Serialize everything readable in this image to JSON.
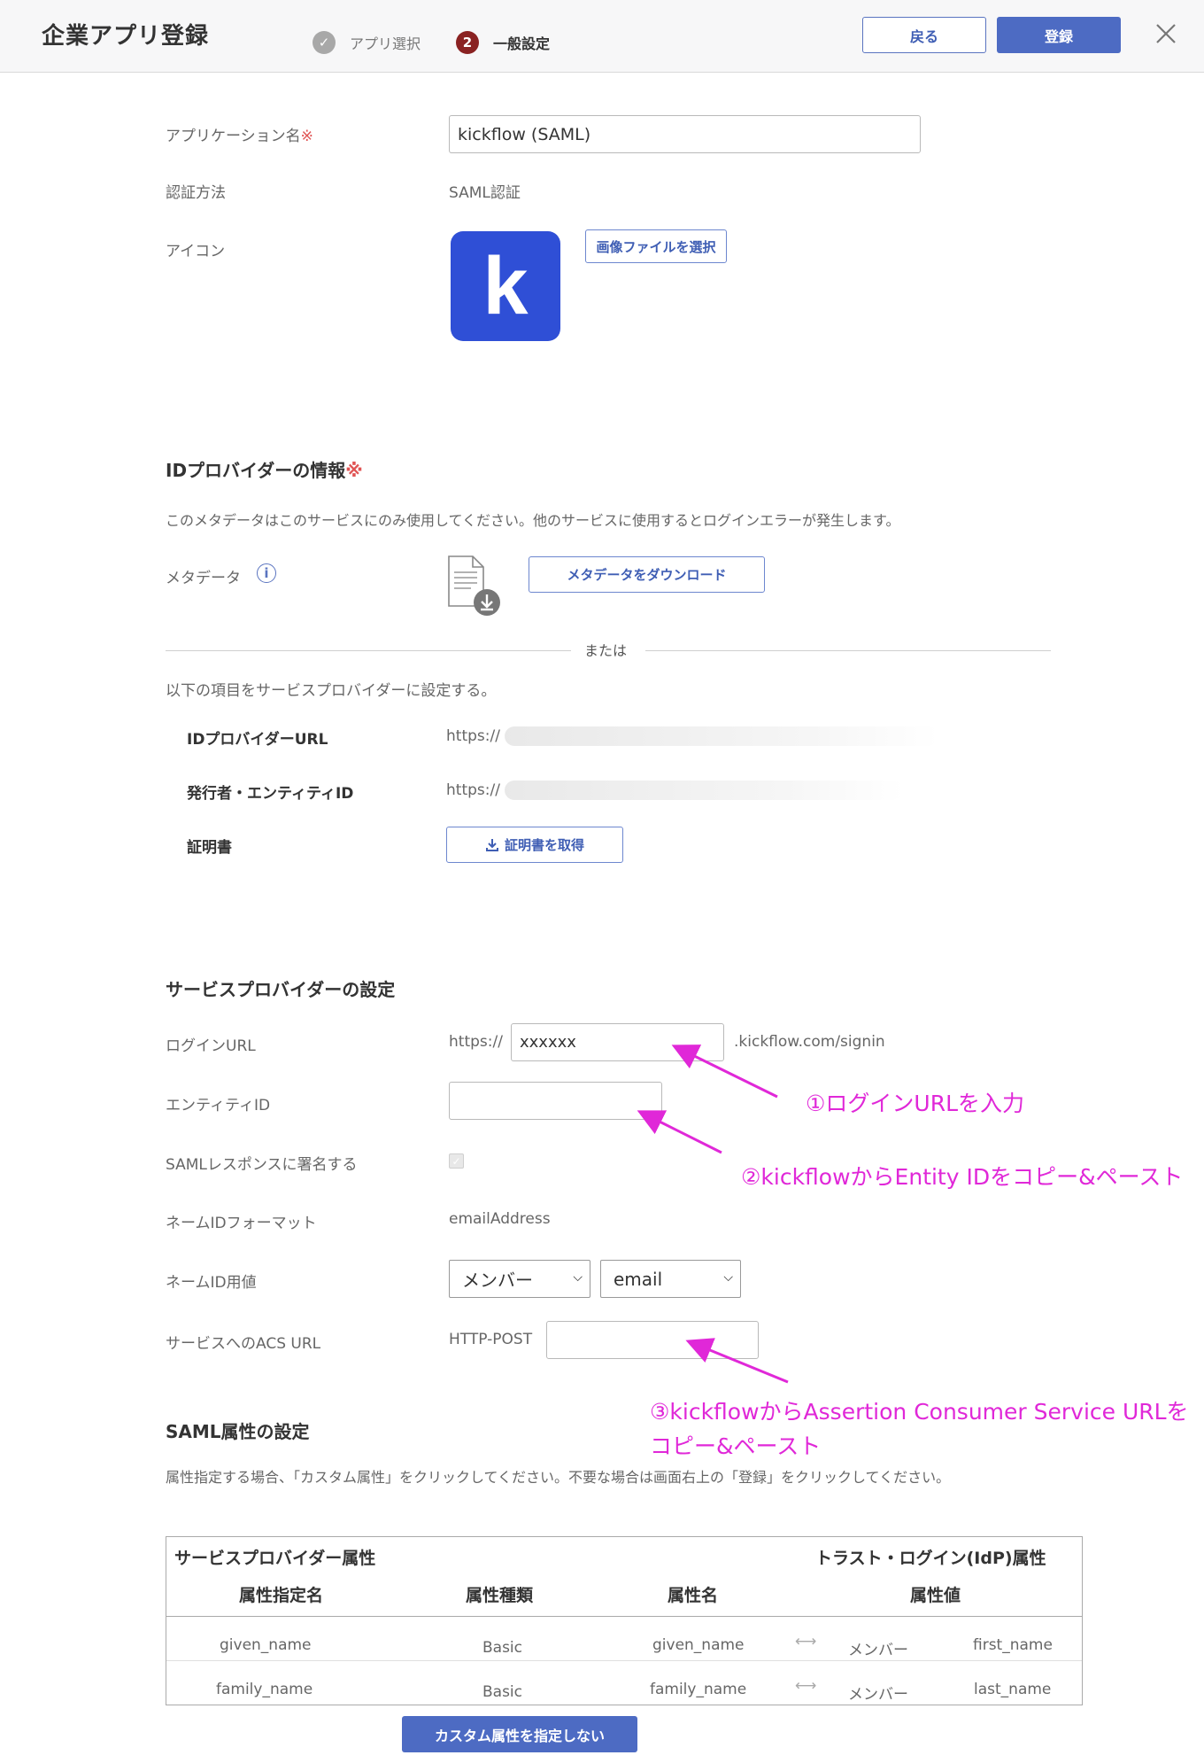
{
  "header": {
    "title": "企業アプリ登録",
    "steps": [
      {
        "label": "アプリ選択",
        "marker": "✓"
      },
      {
        "label": "一般設定",
        "marker": "2"
      }
    ],
    "back_label": "戻る",
    "register_label": "登録",
    "close_symbol": "✕"
  },
  "app": {
    "name_label": "アプリケーション名",
    "required_mark": "※",
    "name_value": "kickflow (SAML)",
    "auth_label": "認証方法",
    "auth_value": "SAML認証",
    "icon_label": "アイコン",
    "icon_letter": "k",
    "icon_color": "#2f4fd6",
    "select_image_label": "画像ファイルを選択"
  },
  "idp": {
    "title": "IDプロバイダーの情報",
    "required_mark": "※",
    "note": "このメタデータはこのサービスにのみ使用してください。他のサービスに使用するとログインエラーが発生します。",
    "metadata_label": "メタデータ",
    "info_symbol": "i",
    "download_label": "メタデータをダウンロード",
    "or_label": "または",
    "manual_note": "以下の項目をサービスプロバイダーに設定する。",
    "idp_url_label": "IDプロバイダーURL",
    "idp_url_value": "https://",
    "entity_label": "発行者・エンティティID",
    "entity_value": "https://",
    "cert_label": "証明書",
    "cert_button": "証明書を取得"
  },
  "sp": {
    "title": "サービスプロバイダーの設定",
    "login_url_label": "ログインURL",
    "login_url_prefix": "https://",
    "login_url_value": "xxxxxx",
    "login_url_suffix": ".kickflow.com/signin",
    "entity_id_label": "エンティティID",
    "entity_id_value": "",
    "sign_label": "SAMLレスポンスに署名する",
    "sign_checked": true,
    "nameid_format_label": "ネームIDフォーマット",
    "nameid_format_value": "emailAddress",
    "nameid_value_label": "ネームID用値",
    "nameid_select1": "メンバー",
    "nameid_select2": "email",
    "acs_label": "サービスへのACS URL",
    "acs_binding": "HTTP-POST",
    "acs_value": ""
  },
  "annotations": {
    "a1": "①ログインURLを入力",
    "a2": "②kickflowからEntity IDをコピー&ペースト",
    "a3_line1": "③kickflowからAssertion Consumer Service URLを",
    "a3_line2": "コピー&ペースト",
    "color": "#e028d8"
  },
  "saml_attr": {
    "title": "SAML属性の設定",
    "note": "属性指定する場合、「カスタム属性」をクリックしてください。不要な場合は画面右上の「登録」をクリックしてください。",
    "table": {
      "sp_header": "サービスプロバイダー属性",
      "idp_header": "トラスト・ログイン(IdP)属性",
      "columns": [
        "属性指定名",
        "属性種類",
        "属性名",
        "属性値"
      ],
      "rows": [
        {
          "name": "given_name",
          "type": "Basic",
          "attr": "given_name",
          "arrow": "⟷",
          "src": "メンバー",
          "value": "first_name"
        },
        {
          "name": "family_name",
          "type": "Basic",
          "attr": "family_name",
          "arrow": "⟷",
          "src": "メンバー",
          "value": "last_name"
        }
      ]
    },
    "custom_button": "カスタム属性を指定しない"
  }
}
